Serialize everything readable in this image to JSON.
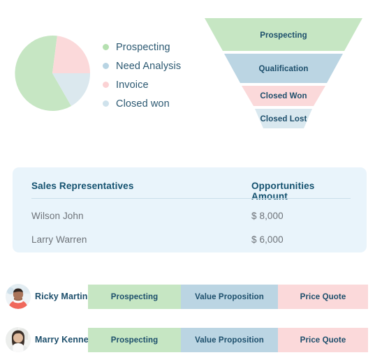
{
  "pie": {
    "name": "opportunity-stage-pie",
    "slices": [
      {
        "label": "Prospecting",
        "value": 50,
        "color": "#c6e6c3"
      },
      {
        "label": "Invoice",
        "value": 27,
        "color": "#fbd9da"
      },
      {
        "label": "Closed won",
        "value": 23,
        "color": "#dbe8ee"
      }
    ]
  },
  "legend": {
    "items": [
      {
        "label": "Prospecting",
        "color": "#b5e0b0"
      },
      {
        "label": "Need Analysis",
        "color": "#b8d4e3"
      },
      {
        "label": "Invoice",
        "color": "#fbd2d4"
      },
      {
        "label": "Closed won",
        "color": "#cfe2ec"
      }
    ]
  },
  "funnel": {
    "stages": [
      {
        "label": "Prospecting",
        "color": "#c6e6c3"
      },
      {
        "label": "Qualification",
        "color": "#bbd5e3"
      },
      {
        "label": "Closed Won",
        "color": "#fbd9da"
      },
      {
        "label": "Closed Lost",
        "color": "#d9e8ef"
      }
    ]
  },
  "table": {
    "columns": [
      "Sales Representatives",
      "Opportunities Amount"
    ],
    "rows": [
      {
        "name": "Wilson John",
        "amount": "$ 8,000"
      },
      {
        "name": "Larry Warren",
        "amount": "$ 6,000"
      }
    ]
  },
  "people": [
    {
      "name": "Ricky Martin",
      "avatar": "avatar-male-photo",
      "stages": [
        {
          "label": "Prospecting",
          "color": "#c6e6c3"
        },
        {
          "label": "Value Proposition",
          "color": "#bbd5e3"
        },
        {
          "label": "Price Quote",
          "color": "#fbd9da"
        }
      ]
    },
    {
      "name": "Marry Kenne",
      "avatar": "avatar-female-photo",
      "stages": [
        {
          "label": "Prospecting",
          "color": "#c6e6c3"
        },
        {
          "label": "Value Proposition",
          "color": "#bbd5e3"
        },
        {
          "label": "Price Quote",
          "color": "#fbd9da"
        }
      ]
    }
  ],
  "colors": {
    "green": "#c6e6c3",
    "blue": "#bbd5e3",
    "pink": "#fbd9da",
    "lightblue": "#d9e8ef",
    "navy": "#1c4e6b",
    "card": "#e9f4fb"
  }
}
